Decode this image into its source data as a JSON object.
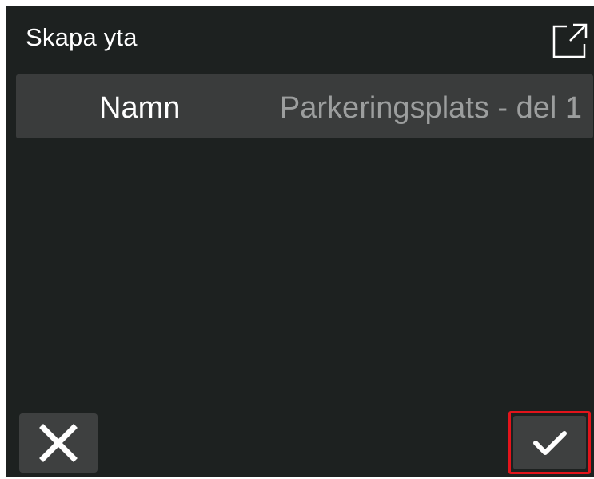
{
  "dialog": {
    "title": "Skapa yta",
    "expand_icon": "open-in-new-icon",
    "name_field": {
      "label": "Namn",
      "value": "Parkeringsplats - del 1"
    },
    "cancel_icon": "close-icon",
    "confirm_icon": "checkmark-icon"
  },
  "colors": {
    "background": "#1d2120",
    "field_background": "#3a3c3c",
    "button_background": "#3e4040",
    "text": "#ffffff",
    "value_text": "#9c9e9e",
    "highlight_border": "#e3141b"
  }
}
